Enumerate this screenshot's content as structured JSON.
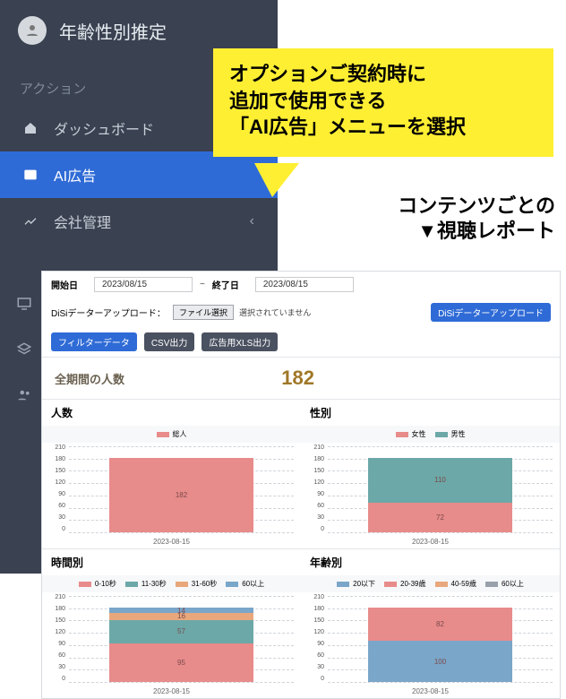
{
  "sidebar": {
    "title": "年齢性別推定",
    "section": "アクション",
    "items": [
      {
        "label": "ダッシュボード",
        "active": false
      },
      {
        "label": "AI広告",
        "active": true
      },
      {
        "label": "会社管理",
        "active": false,
        "caret": true
      }
    ]
  },
  "callout": {
    "l1": "オプションご契約時に",
    "l2": "追加で使用できる",
    "l3": "「AI広告」メニューを選択"
  },
  "headline": {
    "l1": "コンテンツごとの",
    "l2": "▼視聴レポート"
  },
  "report": {
    "startLabel": "開始日",
    "startDate": "2023/08/15",
    "tilde": "~",
    "endLabel": "終了日",
    "endDate": "2023/08/15",
    "uploadLabel": "DiSiデーターアップロード：",
    "fileBtn": "ファイル選択",
    "noFile": "選択されていません",
    "uploadBtn": "DiSiデーターアップロード",
    "filterBtn": "フィルターデータ",
    "csvBtn": "CSV出力",
    "xlsBtn": "広告用XLS出力",
    "statLabel": "全期間の人数",
    "statValue": "182"
  },
  "chart_data": [
    {
      "type": "bar",
      "title": "人数",
      "categories": [
        "2023-08-15"
      ],
      "series": [
        {
          "name": "総人",
          "values": [
            182
          ],
          "color": "#e88b8b"
        }
      ],
      "ylim": [
        0,
        210
      ]
    },
    {
      "type": "bar",
      "title": "性別",
      "categories": [
        "2023-08-15"
      ],
      "series": [
        {
          "name": "女性",
          "values": [
            72
          ],
          "color": "#e88b8b"
        },
        {
          "name": "男性",
          "values": [
            110
          ],
          "color": "#6ca8a8"
        }
      ],
      "ylim": [
        0,
        210
      ],
      "labels": [
        "72",
        "110"
      ]
    },
    {
      "type": "bar",
      "title": "時間別",
      "categories": [
        "2023-08-15"
      ],
      "series": [
        {
          "name": "0-10秒",
          "values": [
            95
          ],
          "color": "#e88b8b"
        },
        {
          "name": "11-30秒",
          "values": [
            57
          ],
          "color": "#6ca8a8"
        },
        {
          "name": "31-60秒",
          "values": [
            16
          ],
          "color": "#e8a87c"
        },
        {
          "name": "60以上",
          "values": [
            14
          ],
          "color": "#7aa6c9"
        }
      ],
      "ylim": [
        0,
        210
      ],
      "labels": [
        "95",
        "57",
        "16",
        "14"
      ]
    },
    {
      "type": "bar",
      "title": "年齢別",
      "categories": [
        "2023-08-15"
      ],
      "series": [
        {
          "name": "20以下",
          "values": [
            100
          ],
          "color": "#7aa6c9"
        },
        {
          "name": "20-39歳",
          "values": [
            82
          ],
          "color": "#e88b8b"
        },
        {
          "name": "40-59歳",
          "values": [
            0
          ],
          "color": "#e8a87c"
        },
        {
          "name": "60以上",
          "values": [
            0
          ],
          "color": "#98a0ab"
        }
      ],
      "ylim": [
        0,
        210
      ],
      "labels": [
        "100",
        "82"
      ]
    }
  ],
  "yticks": [
    "210",
    "180",
    "150",
    "120",
    "90",
    "60",
    "30",
    "0"
  ]
}
